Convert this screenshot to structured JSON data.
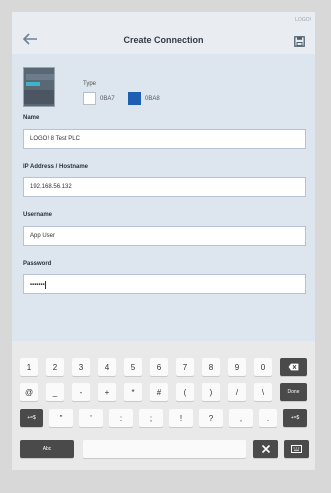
{
  "header": {
    "brand": "LOGO!",
    "title": "Create Connection"
  },
  "type": {
    "label": "Type",
    "options": [
      {
        "label": "0BA7",
        "selected": false
      },
      {
        "label": "0BA8",
        "selected": true
      }
    ],
    "selected_color": "#1e5fb3"
  },
  "fields": {
    "name": {
      "label": "Name",
      "value": "LOGO! 8 Test PLC"
    },
    "address": {
      "label": "IP Address / Hostname",
      "value": "192.168.56.132"
    },
    "username": {
      "label": "Username",
      "value": "App User"
    },
    "password": {
      "label": "Password",
      "value": "•••••••"
    }
  },
  "keyboard": {
    "row1": [
      "1",
      "2",
      "3",
      "4",
      "5",
      "6",
      "7",
      "8",
      "9",
      "0"
    ],
    "row2": [
      "@",
      "_",
      "-",
      "+",
      "*",
      "#",
      "(",
      ")",
      "/",
      "\\"
    ],
    "row2_action": "Done",
    "row3_shift": "+=$",
    "row3": [
      "\"",
      "'",
      ":",
      ";",
      "!",
      "?",
      ",",
      "."
    ],
    "row4_abc": "Abc",
    "icons": [
      "backspace-icon",
      "tools-icon",
      "keyboard-hide-icon"
    ]
  }
}
